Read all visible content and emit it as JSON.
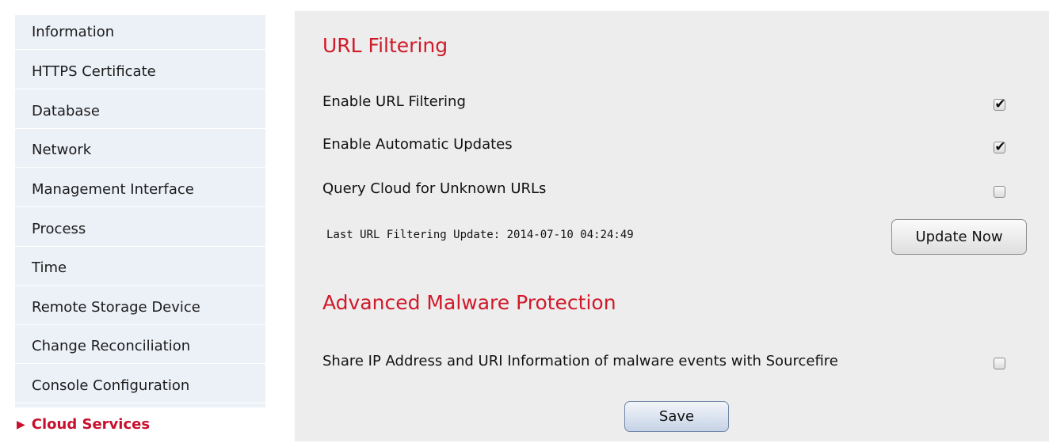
{
  "sidebar": {
    "items": [
      {
        "label": "Information"
      },
      {
        "label": "HTTPS Certificate"
      },
      {
        "label": "Database"
      },
      {
        "label": "Network"
      },
      {
        "label": "Management Interface"
      },
      {
        "label": "Process"
      },
      {
        "label": "Time"
      },
      {
        "label": "Remote Storage Device"
      },
      {
        "label": "Change Reconciliation"
      },
      {
        "label": "Console Configuration"
      },
      {
        "label": "Cloud Services",
        "active": true,
        "marker": "▶"
      }
    ]
  },
  "url_filtering": {
    "title": "URL Filtering",
    "options": [
      {
        "label": "Enable URL Filtering",
        "checked": true
      },
      {
        "label": "Enable Automatic Updates",
        "checked": true
      },
      {
        "label": "Query Cloud for Unknown URLs",
        "checked": false
      }
    ],
    "last_update_text": "Last URL Filtering Update: 2014-07-10 04:24:49",
    "update_button": "Update Now"
  },
  "amp": {
    "title": "Advanced Malware Protection",
    "options": [
      {
        "label": "Share IP Address and URI Information of malware events with Sourcefire",
        "checked": false
      }
    ]
  },
  "save_button": "Save",
  "colors": {
    "accent": "#d01a2a",
    "sidebar_bg": "#ecf0f7",
    "panel_bg": "#ededed"
  },
  "check_glyph": "✔"
}
